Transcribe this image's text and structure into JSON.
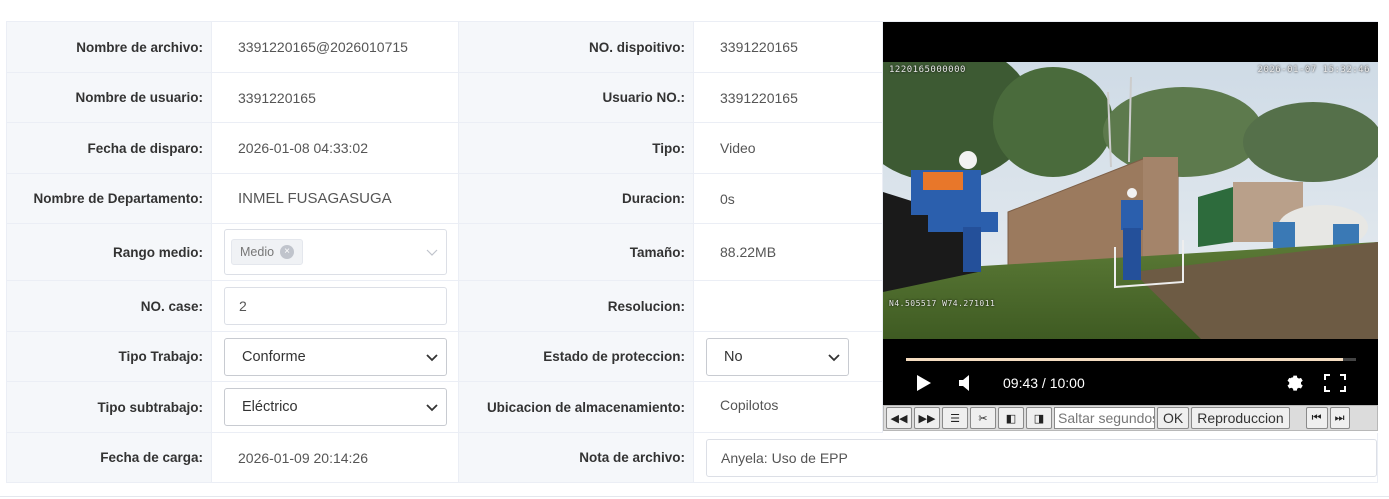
{
  "left": {
    "rows": [
      {
        "label": "Nombre de archivo:",
        "value": "3391220165@2026010715"
      },
      {
        "label": "Nombre de usuario:",
        "value": "3391220165"
      },
      {
        "label": "Fecha de disparo:",
        "value": "2026-01-08 04:33:02"
      },
      {
        "label": "Nombre de Departamento:",
        "value": "INMEL FUSAGASUGA"
      },
      {
        "label": "Rango medio:",
        "tag": "Medio"
      },
      {
        "label": "NO. case:",
        "input": "2"
      },
      {
        "label": "Tipo Trabajo:",
        "select": "Conforme"
      },
      {
        "label": "Tipo subtrabajo:",
        "select": "Eléctrico"
      },
      {
        "label": "Fecha de carga:",
        "value": "2026-01-09 20:14:26"
      }
    ]
  },
  "right": {
    "rows": [
      {
        "label": "NO. dispoitivo:",
        "value": "3391220165"
      },
      {
        "label": "Usuario NO.:",
        "value": "3391220165"
      },
      {
        "label": "Tipo:",
        "value": "Video"
      },
      {
        "label": "Duracion:",
        "value": "0s"
      },
      {
        "label": "Tamaño:",
        "value": "88.22MB"
      },
      {
        "label": "Resolucion:",
        "value": ""
      },
      {
        "label": "Estado de proteccion:",
        "select": "No"
      },
      {
        "label": "Ubicacion de almacenamiento:",
        "value": "Copilotos"
      },
      {
        "label": "Nota de archivo:",
        "input": "Anyela: Uso de EPP"
      }
    ]
  },
  "video": {
    "overlay_top_left": "1220165000000",
    "overlay_top_right": "2026-01-07 15:32:46",
    "overlay_gps": "N4.505517 W74.271011",
    "time": "09:43 / 10:00",
    "progress": 0.972
  },
  "toolbar": {
    "skip_placeholder": "Saltar segundos",
    "ok_label": "OK",
    "playback_label": "Reproduccion"
  },
  "colors": {
    "label_bg": "#f5f7fa",
    "border": "#ebeef5",
    "accent": "#f4dcc0"
  }
}
